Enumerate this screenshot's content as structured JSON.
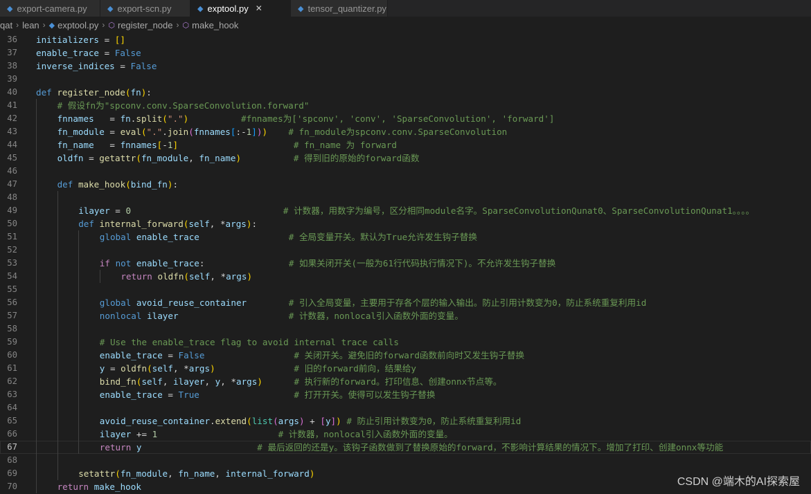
{
  "tabs": [
    {
      "label": "export-camera.py",
      "active": false
    },
    {
      "label": "export-scn.py",
      "active": false
    },
    {
      "label": "exptool.py",
      "active": true
    },
    {
      "label": "tensor_quantizer.py",
      "active": false
    }
  ],
  "breadcrumb": [
    "qat",
    "lean",
    "exptool.py",
    "register_node",
    "make_hook"
  ],
  "current_line": 67,
  "lines": [
    {
      "n": 36,
      "indent": 0,
      "t": [
        [
          "var",
          "initializers"
        ],
        [
          "op",
          " = "
        ],
        [
          "b1",
          "[]"
        ]
      ]
    },
    {
      "n": 37,
      "indent": 0,
      "t": [
        [
          "var",
          "enable_trace"
        ],
        [
          "op",
          " = "
        ],
        [
          "kw",
          "False"
        ]
      ]
    },
    {
      "n": 38,
      "indent": 0,
      "t": [
        [
          "var",
          "inverse_indices"
        ],
        [
          "op",
          " = "
        ],
        [
          "kw",
          "False"
        ]
      ]
    },
    {
      "n": 39,
      "indent": 0,
      "t": []
    },
    {
      "n": 40,
      "indent": 0,
      "t": [
        [
          "kw",
          "def"
        ],
        [
          "op",
          " "
        ],
        [
          "fn",
          "register_node"
        ],
        [
          "b1",
          "("
        ],
        [
          "var",
          "fn"
        ],
        [
          "b1",
          ")"
        ],
        [
          "op",
          ":"
        ]
      ]
    },
    {
      "n": 41,
      "indent": 1,
      "t": [
        [
          "cm",
          "# 假设fn为\"spconv.conv.SparseConvolution.forward\""
        ]
      ]
    },
    {
      "n": 42,
      "indent": 1,
      "t": [
        [
          "var",
          "fnnames"
        ],
        [
          "op",
          "   = "
        ],
        [
          "var",
          "fn"
        ],
        [
          "op",
          "."
        ],
        [
          "fn",
          "split"
        ],
        [
          "b1",
          "("
        ],
        [
          "str",
          "\".\""
        ],
        [
          "b1",
          ")"
        ],
        [
          "op",
          "          "
        ],
        [
          "cm",
          "#fnnames为['spconv', 'conv', 'SparseConvolution', 'forward']"
        ]
      ]
    },
    {
      "n": 43,
      "indent": 1,
      "t": [
        [
          "var",
          "fn_module"
        ],
        [
          "op",
          " = "
        ],
        [
          "fn",
          "eval"
        ],
        [
          "b1",
          "("
        ],
        [
          "str",
          "\".\""
        ],
        [
          "op",
          "."
        ],
        [
          "fn",
          "join"
        ],
        [
          "b2",
          "("
        ],
        [
          "var",
          "fnnames"
        ],
        [
          "b3",
          "["
        ],
        [
          "op",
          ":-"
        ],
        [
          "num",
          "1"
        ],
        [
          "b3",
          "]"
        ],
        [
          "b2",
          ")"
        ],
        [
          "b1",
          ")"
        ],
        [
          "op",
          "    "
        ],
        [
          "cm",
          "# fn_module为spconv.conv.SparseConvolution"
        ]
      ]
    },
    {
      "n": 44,
      "indent": 1,
      "t": [
        [
          "var",
          "fn_name"
        ],
        [
          "op",
          "   = "
        ],
        [
          "var",
          "fnnames"
        ],
        [
          "b1",
          "["
        ],
        [
          "op",
          "-"
        ],
        [
          "num",
          "1"
        ],
        [
          "b1",
          "]"
        ],
        [
          "op",
          "                      "
        ],
        [
          "cm",
          "# fn_name 为 forward"
        ]
      ]
    },
    {
      "n": 45,
      "indent": 1,
      "t": [
        [
          "var",
          "oldfn"
        ],
        [
          "op",
          " = "
        ],
        [
          "fn",
          "getattr"
        ],
        [
          "b1",
          "("
        ],
        [
          "var",
          "fn_module"
        ],
        [
          "op",
          ", "
        ],
        [
          "var",
          "fn_name"
        ],
        [
          "b1",
          ")"
        ],
        [
          "op",
          "          "
        ],
        [
          "cm",
          "# 得到旧的原始的forward函数"
        ]
      ]
    },
    {
      "n": 46,
      "indent": 1,
      "t": []
    },
    {
      "n": 47,
      "indent": 1,
      "t": [
        [
          "kw",
          "def"
        ],
        [
          "op",
          " "
        ],
        [
          "fn",
          "make_hook"
        ],
        [
          "b1",
          "("
        ],
        [
          "var",
          "bind_fn"
        ],
        [
          "b1",
          ")"
        ],
        [
          "op",
          ":"
        ]
      ]
    },
    {
      "n": 48,
      "indent": 2,
      "t": []
    },
    {
      "n": 49,
      "indent": 2,
      "t": [
        [
          "var",
          "ilayer"
        ],
        [
          "op",
          " = "
        ],
        [
          "num",
          "0"
        ],
        [
          "op",
          "                             "
        ],
        [
          "cm",
          "# 计数器，用数字为编号，区分相同module名字。SparseConvolutionQunat0、SparseConvolutionQunat1。。。。"
        ]
      ]
    },
    {
      "n": 50,
      "indent": 2,
      "t": [
        [
          "kw",
          "def"
        ],
        [
          "op",
          " "
        ],
        [
          "fn",
          "internal_forward"
        ],
        [
          "b1",
          "("
        ],
        [
          "var",
          "self"
        ],
        [
          "op",
          ", *"
        ],
        [
          "var",
          "args"
        ],
        [
          "b1",
          ")"
        ],
        [
          "op",
          ":"
        ]
      ]
    },
    {
      "n": 51,
      "indent": 3,
      "t": [
        [
          "kw",
          "global"
        ],
        [
          "op",
          " "
        ],
        [
          "var",
          "enable_trace"
        ],
        [
          "op",
          "                 "
        ],
        [
          "cm",
          "# 全局变量开关。默认为True允许发生钩子替换"
        ]
      ]
    },
    {
      "n": 52,
      "indent": 3,
      "t": []
    },
    {
      "n": 53,
      "indent": 3,
      "t": [
        [
          "ctrl",
          "if"
        ],
        [
          "op",
          " "
        ],
        [
          "kw",
          "not"
        ],
        [
          "op",
          " "
        ],
        [
          "var",
          "enable_trace"
        ],
        [
          "op",
          ":                "
        ],
        [
          "cm",
          "# 如果关闭开关(一般为61行代码执行情况下)。不允许发生钩子替换"
        ]
      ]
    },
    {
      "n": 54,
      "indent": 4,
      "t": [
        [
          "ctrl",
          "return"
        ],
        [
          "op",
          " "
        ],
        [
          "fn",
          "oldfn"
        ],
        [
          "b1",
          "("
        ],
        [
          "var",
          "self"
        ],
        [
          "op",
          ", *"
        ],
        [
          "var",
          "args"
        ],
        [
          "b1",
          ")"
        ]
      ]
    },
    {
      "n": 55,
      "indent": 3,
      "t": []
    },
    {
      "n": 56,
      "indent": 3,
      "t": [
        [
          "kw",
          "global"
        ],
        [
          "op",
          " "
        ],
        [
          "var",
          "avoid_reuse_container"
        ],
        [
          "op",
          "        "
        ],
        [
          "cm",
          "# 引入全局变量，主要用于存各个层的输入输出。防止引用计数变为0，防止系统重复利用id"
        ]
      ]
    },
    {
      "n": 57,
      "indent": 3,
      "t": [
        [
          "kw",
          "nonlocal"
        ],
        [
          "op",
          " "
        ],
        [
          "var",
          "ilayer"
        ],
        [
          "op",
          "                     "
        ],
        [
          "cm",
          "# 计数器，nonlocal引入函数外面的变量。"
        ]
      ]
    },
    {
      "n": 58,
      "indent": 3,
      "t": []
    },
    {
      "n": 59,
      "indent": 3,
      "t": [
        [
          "cm",
          "# Use the enable_trace flag to avoid internal trace calls"
        ]
      ]
    },
    {
      "n": 60,
      "indent": 3,
      "t": [
        [
          "var",
          "enable_trace"
        ],
        [
          "op",
          " = "
        ],
        [
          "kw",
          "False"
        ],
        [
          "op",
          "                 "
        ],
        [
          "cm",
          "# 关闭开关。避免旧的forward函数前向时又发生钩子替换"
        ]
      ]
    },
    {
      "n": 61,
      "indent": 3,
      "t": [
        [
          "var",
          "y"
        ],
        [
          "op",
          " = "
        ],
        [
          "fn",
          "oldfn"
        ],
        [
          "b1",
          "("
        ],
        [
          "var",
          "self"
        ],
        [
          "op",
          ", *"
        ],
        [
          "var",
          "args"
        ],
        [
          "b1",
          ")"
        ],
        [
          "op",
          "               "
        ],
        [
          "cm",
          "# 旧的forward前向，结果给y"
        ]
      ]
    },
    {
      "n": 62,
      "indent": 3,
      "t": [
        [
          "fn",
          "bind_fn"
        ],
        [
          "b1",
          "("
        ],
        [
          "var",
          "self"
        ],
        [
          "op",
          ", "
        ],
        [
          "var",
          "ilayer"
        ],
        [
          "op",
          ", "
        ],
        [
          "var",
          "y"
        ],
        [
          "op",
          ", *"
        ],
        [
          "var",
          "args"
        ],
        [
          "b1",
          ")"
        ],
        [
          "op",
          "      "
        ],
        [
          "cm",
          "# 执行新的forward。打印信息、创建onnx节点等。"
        ]
      ]
    },
    {
      "n": 63,
      "indent": 3,
      "t": [
        [
          "var",
          "enable_trace"
        ],
        [
          "op",
          " = "
        ],
        [
          "kw",
          "True"
        ],
        [
          "op",
          "                  "
        ],
        [
          "cm",
          "# 打开开关。使得可以发生钩子替换"
        ]
      ]
    },
    {
      "n": 64,
      "indent": 3,
      "t": []
    },
    {
      "n": 65,
      "indent": 3,
      "t": [
        [
          "var",
          "avoid_reuse_container"
        ],
        [
          "op",
          "."
        ],
        [
          "fn",
          "extend"
        ],
        [
          "b1",
          "("
        ],
        [
          "cls",
          "list"
        ],
        [
          "b2",
          "("
        ],
        [
          "var",
          "args"
        ],
        [
          "b2",
          ")"
        ],
        [
          "op",
          " + "
        ],
        [
          "b2",
          "["
        ],
        [
          "var",
          "y"
        ],
        [
          "b2",
          "]"
        ],
        [
          "b1",
          ")"
        ],
        [
          "op",
          " "
        ],
        [
          "cm",
          "# 防止引用计数变为0，防止系统重复利用id"
        ]
      ]
    },
    {
      "n": 66,
      "indent": 3,
      "t": [
        [
          "var",
          "ilayer"
        ],
        [
          "op",
          " += "
        ],
        [
          "num",
          "1"
        ],
        [
          "op",
          "                       "
        ],
        [
          "cm",
          "# 计数器，nonlocal引入函数外面的变量。"
        ]
      ]
    },
    {
      "n": 67,
      "indent": 3,
      "t": [
        [
          "ctrl",
          "return"
        ],
        [
          "op",
          " "
        ],
        [
          "var",
          "y"
        ],
        [
          "op",
          "                      "
        ],
        [
          "cm",
          "# 最后返回的还是y。该钩子函数做到了替换原始的forward，不影响计算结果的情况下。增加了打印、创建onnx等功能"
        ]
      ]
    },
    {
      "n": 68,
      "indent": 2,
      "t": []
    },
    {
      "n": 69,
      "indent": 2,
      "t": [
        [
          "fn",
          "setattr"
        ],
        [
          "b1",
          "("
        ],
        [
          "var",
          "fn_module"
        ],
        [
          "op",
          ", "
        ],
        [
          "var",
          "fn_name"
        ],
        [
          "op",
          ", "
        ],
        [
          "var",
          "internal_forward"
        ],
        [
          "b1",
          ")"
        ]
      ]
    },
    {
      "n": 70,
      "indent": 1,
      "t": [
        [
          "ctrl",
          "return"
        ],
        [
          "op",
          " "
        ],
        [
          "var",
          "make_hook"
        ]
      ]
    }
  ],
  "watermark": "CSDN @端木的AI探索屋"
}
